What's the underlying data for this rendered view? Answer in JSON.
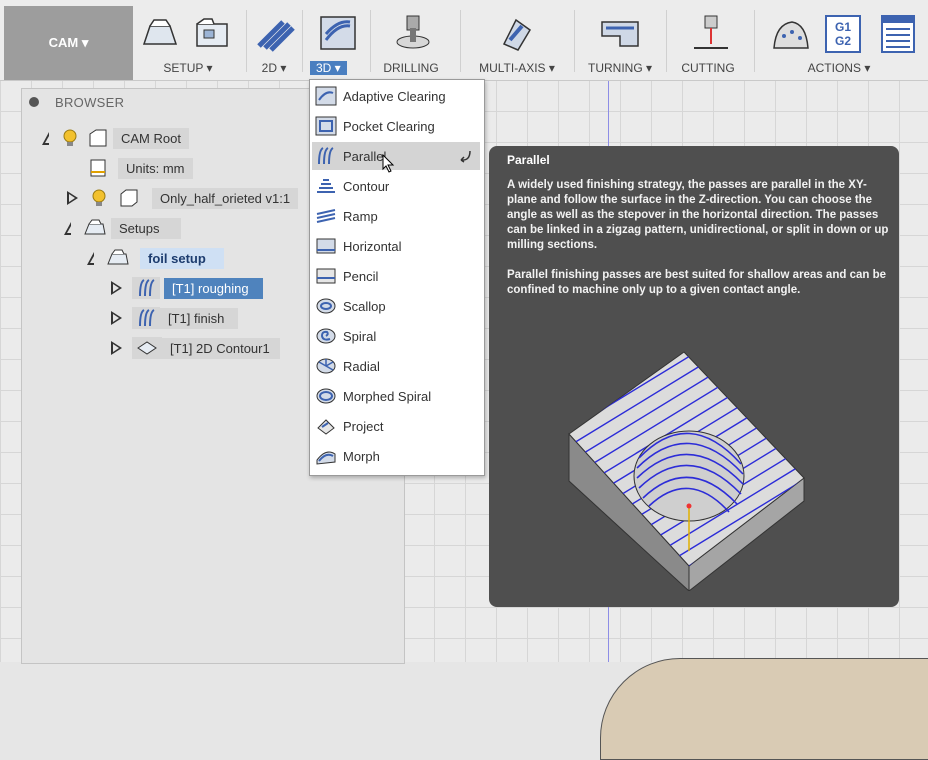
{
  "toolbar": {
    "cam_label": "CAM ▾",
    "groups": [
      {
        "label": "SETUP ▾"
      },
      {
        "label": "2D ▾"
      },
      {
        "label": "3D ▾"
      },
      {
        "label": "DRILLING"
      },
      {
        "label": "MULTI-AXIS ▾"
      },
      {
        "label": "TURNING ▾"
      },
      {
        "label": "CUTTING"
      },
      {
        "label": "ACTIONS ▾"
      }
    ],
    "g1g2_text": "G1\nG2"
  },
  "browser": {
    "title": "BROWSER",
    "nodes": [
      {
        "label": "CAM Root"
      },
      {
        "label": "Units: mm"
      },
      {
        "label": "Only_half_orieted v1:1"
      },
      {
        "label": "Setups"
      },
      {
        "label": "foil setup"
      },
      {
        "label": "[T1] roughing"
      },
      {
        "label": "[T1] finish"
      },
      {
        "label": "[T1] 2D Contour1"
      }
    ]
  },
  "menu3d": {
    "items": [
      {
        "label": "Adaptive Clearing"
      },
      {
        "label": "Pocket Clearing"
      },
      {
        "label": "Parallel"
      },
      {
        "label": "Contour"
      },
      {
        "label": "Ramp"
      },
      {
        "label": "Horizontal"
      },
      {
        "label": "Pencil"
      },
      {
        "label": "Scallop"
      },
      {
        "label": "Spiral"
      },
      {
        "label": "Radial"
      },
      {
        "label": "Morphed Spiral"
      },
      {
        "label": "Project"
      },
      {
        "label": "Morph"
      }
    ],
    "active_index": 2
  },
  "tooltip": {
    "title": "Parallel",
    "paragraph1": "A widely used finishing strategy, the passes are parallel in the XY-plane and follow the surface in the Z-direction. You can choose the angle as well as the stepover in the horizontal direction. The passes can be linked in a zigzag pattern, unidirectional, or split in down or up milling sections.",
    "paragraph2": "Parallel finishing passes are best suited for shallow areas and can be confined to machine only up to a given contact angle."
  },
  "colors": {
    "accent": "#4f83bd",
    "tooltip_bg": "#4f4f4f",
    "toolpath": "#2c2cd8"
  }
}
